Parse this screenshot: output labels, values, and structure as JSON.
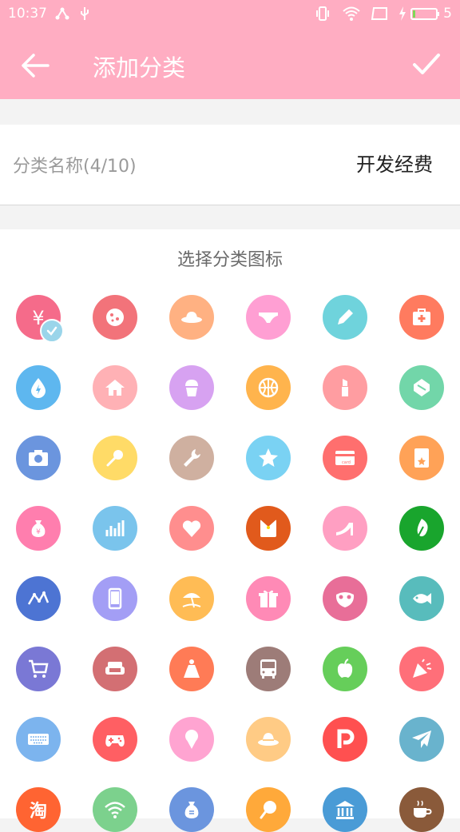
{
  "status_bar": {
    "time": "10:37",
    "battery_level": "5"
  },
  "app_bar": {
    "title": "添加分类"
  },
  "name_row": {
    "label": "分类名称(4/10)",
    "value": "开发经费"
  },
  "icon_section": {
    "title": "选择分类图标"
  },
  "icons": [
    {
      "name": "yen-icon",
      "color": "#f56b8a",
      "selected": true
    },
    {
      "name": "cookie-icon",
      "color": "#f2737a"
    },
    {
      "name": "hat-icon",
      "color": "#ffb182"
    },
    {
      "name": "underwear-icon",
      "color": "#ff9fd3"
    },
    {
      "name": "pencil-icon",
      "color": "#6fd3dc"
    },
    {
      "name": "first-aid-icon",
      "color": "#ff7b5f"
    },
    {
      "name": "water-drop-icon",
      "color": "#5eb7ef"
    },
    {
      "name": "house-icon",
      "color": "#ffb1b5"
    },
    {
      "name": "cupcake-icon",
      "color": "#d7a2f1"
    },
    {
      "name": "basketball-icon",
      "color": "#ffb44d"
    },
    {
      "name": "lipstick-icon",
      "color": "#ff9da1"
    },
    {
      "name": "towel-icon",
      "color": "#72d6a9"
    },
    {
      "name": "camera-icon",
      "color": "#6b95de"
    },
    {
      "name": "microphone-icon",
      "color": "#ffdb67"
    },
    {
      "name": "wrench-icon",
      "color": "#cfb0a0"
    },
    {
      "name": "star-icon",
      "color": "#7ad2f3"
    },
    {
      "name": "card-icon",
      "color": "#ff6f6e"
    },
    {
      "name": "red-envelope-icon",
      "color": "#ffa257"
    },
    {
      "name": "money-bag-icon",
      "color": "#ff7eae"
    },
    {
      "name": "bar-chart-icon",
      "color": "#7ac4ec"
    },
    {
      "name": "heart-icon",
      "color": "#ff8e8e"
    },
    {
      "name": "envelope-icon",
      "color": "#e15a1c"
    },
    {
      "name": "high-heel-icon",
      "color": "#ff9fc2"
    },
    {
      "name": "leaf-icon",
      "color": "#19a52d"
    },
    {
      "name": "wave-chart-icon",
      "color": "#4d74d3"
    },
    {
      "name": "phone-icon",
      "color": "#a39ef5"
    },
    {
      "name": "beach-icon",
      "color": "#ffbc55"
    },
    {
      "name": "gift-icon",
      "color": "#ff8ab6"
    },
    {
      "name": "mask-icon",
      "color": "#e86e98"
    },
    {
      "name": "fish-icon",
      "color": "#58bcbc"
    },
    {
      "name": "cart-icon",
      "color": "#7a78d5"
    },
    {
      "name": "sofa-icon",
      "color": "#d36f73"
    },
    {
      "name": "dress-icon",
      "color": "#ff7b56"
    },
    {
      "name": "bus-icon",
      "color": "#9d7c78"
    },
    {
      "name": "apple-icon",
      "color": "#66ce5a"
    },
    {
      "name": "party-icon",
      "color": "#ff6f79"
    },
    {
      "name": "keyboard-icon",
      "color": "#7cb4ee"
    },
    {
      "name": "gamepad-icon",
      "color": "#ff5f63"
    },
    {
      "name": "ice-cream-icon",
      "color": "#ffa4d1"
    },
    {
      "name": "sun-hat-icon",
      "color": "#ffcb85"
    },
    {
      "name": "p-logo-icon",
      "color": "#ff5050"
    },
    {
      "name": "airplane-icon",
      "color": "#69b3cd"
    },
    {
      "name": "taobao-icon",
      "color": "#ff6432"
    },
    {
      "name": "wifi-icon",
      "color": "#7cd18d"
    },
    {
      "name": "bag-icon",
      "color": "#6b95de"
    },
    {
      "name": "chicken-icon",
      "color": "#ffa93a"
    },
    {
      "name": "bank-icon",
      "color": "#4a9bd6"
    },
    {
      "name": "coffee-icon",
      "color": "#8a5a3a"
    }
  ]
}
